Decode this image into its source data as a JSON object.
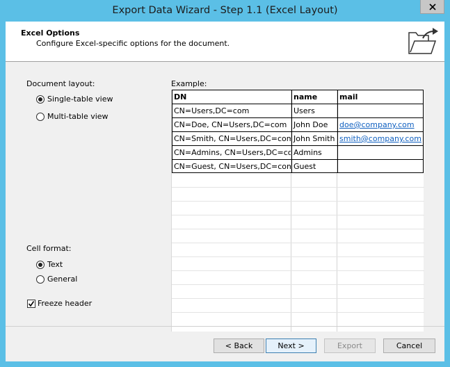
{
  "window": {
    "title": "Export Data Wizard - Step 1.1 (Excel Layout)",
    "close_glyph": "✕"
  },
  "header": {
    "title": "Excel Options",
    "subtitle": "Configure Excel-specific options for the document.",
    "icon": "folder-export-icon"
  },
  "document_layout": {
    "label": "Document layout:",
    "options": [
      {
        "label": "Single-table view",
        "selected": true
      },
      {
        "label": "Multi-table view",
        "selected": false
      }
    ]
  },
  "cell_format": {
    "label": "Cell format:",
    "options": [
      {
        "label": "Text",
        "selected": true
      },
      {
        "label": "General",
        "selected": false
      }
    ]
  },
  "freeze_header": {
    "label": "Freeze header",
    "checked": true
  },
  "example": {
    "label": "Example:",
    "columns": [
      "DN",
      "name",
      "mail"
    ],
    "rows": [
      [
        "CN=Users,DC=com",
        "Users",
        ""
      ],
      [
        "CN=Doe, CN=Users,DC=com",
        "John Doe",
        "doe@company.com"
      ],
      [
        "CN=Smith, CN=Users,DC=com",
        "John Smith",
        "smith@company.com"
      ],
      [
        "CN=Admins, CN=Users,DC=com",
        "Admins",
        ""
      ],
      [
        "CN=Guest, CN=Users,DC=com",
        "Guest",
        ""
      ]
    ]
  },
  "buttons": {
    "back": "< Back",
    "next": "Next >",
    "export": "Export",
    "cancel": "Cancel"
  },
  "colors": {
    "frame": "#5bbfe6",
    "link": "#1060c0"
  }
}
